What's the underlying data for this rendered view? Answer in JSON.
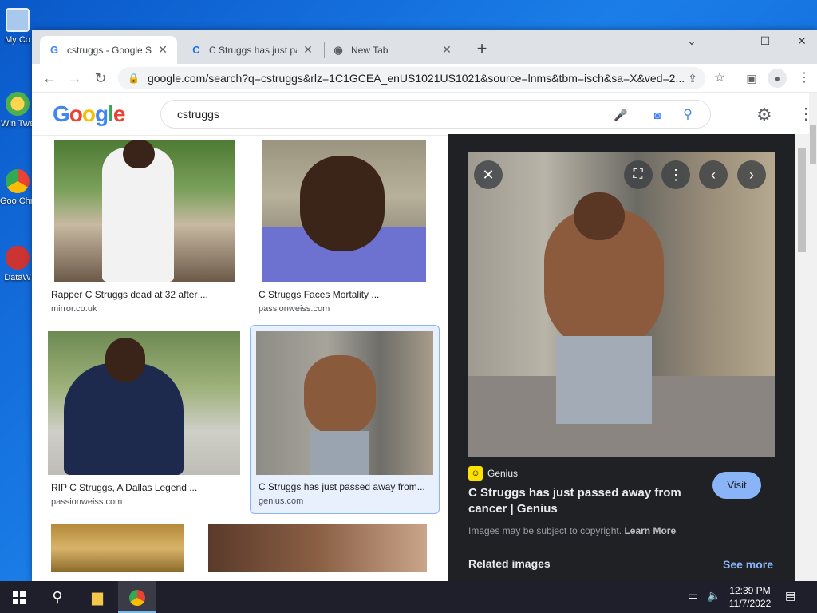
{
  "desktop": {
    "icons": [
      {
        "label": "My Co",
        "icon": "computer-icon"
      },
      {
        "label": "Win Twe",
        "icon": "tweaker-icon"
      },
      {
        "label": "Goo Chro",
        "icon": "chrome-icon"
      },
      {
        "label": "DataW",
        "icon": "datawrapper-icon"
      }
    ]
  },
  "browser": {
    "tabs": [
      {
        "title": "cstruggs - Google Se",
        "favicon": "G",
        "active": true
      },
      {
        "title": "C Struggs has just pa",
        "favicon": "C",
        "active": false
      },
      {
        "title": "New Tab",
        "favicon": "◉",
        "active": false
      }
    ],
    "new_tab": "+",
    "window_controls": {
      "dropdown": "⌄",
      "minimize": "—",
      "maximize": "☐",
      "close": "✕"
    },
    "toolbar": {
      "back": "←",
      "forward": "→",
      "reload": "↻"
    },
    "url": "google.com/search?q=cstruggs&rlz=1C1GCEA_enUS1021US1021&source=lnms&tbm=isch&sa=X&ved=2..."
  },
  "google": {
    "logo": "Google",
    "query": "cstruggs",
    "results": [
      {
        "caption": "Rapper C Struggs dead at 32 after ...",
        "source": "mirror.co.uk"
      },
      {
        "caption": "C Struggs Faces Mortality ...",
        "source": "passionweiss.com"
      },
      {
        "caption": "RIP C Struggs, A Dallas Legend ...",
        "source": "passionweiss.com"
      },
      {
        "caption": "C Struggs has just passed away from...",
        "source": "genius.com"
      }
    ],
    "preview": {
      "source_name": "Genius",
      "source_badge": "☺",
      "title": "C Struggs has just passed away from cancer | Genius",
      "visit_label": "Visit",
      "copyright_text": "Images may be subject to copyright.",
      "learn_more": "Learn More",
      "related_label": "Related images",
      "see_more": "See more"
    }
  },
  "taskbar": {
    "time": "12:39 PM",
    "date": "11/7/2022"
  },
  "colors": {
    "google_blue": "#4285f4",
    "google_red": "#ea4335",
    "google_yellow": "#fbbc05",
    "google_green": "#34a853",
    "preview_bg": "#202124",
    "visit_btn": "#8ab4f8"
  }
}
